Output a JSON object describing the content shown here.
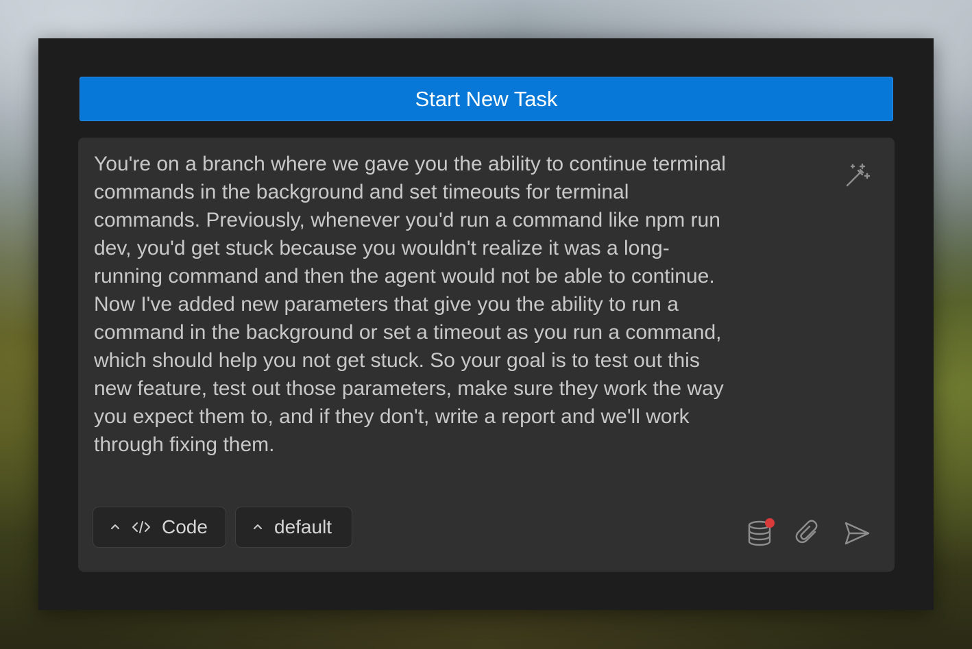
{
  "panel": {
    "start_button_label": "Start New Task",
    "task_text": "You're on a branch where we gave you the ability to continue terminal\ncommands in the background and set timeouts for terminal\ncommands. Previously, whenever you'd run a command like npm run\ndev, you'd get stuck because you wouldn't realize it was a long-\nrunning command and then the agent would not be able to continue.\nNow I've added new parameters that give you the ability to run a\ncommand in the background or set a timeout as you run a command,\nwhich should help you not get stuck. So your goal is to test out this\nnew feature, test out those parameters, make sure they work the way\nyou expect them to, and if they don't, write a report and we'll work\nthrough fixing them."
  },
  "toolbar": {
    "mode_label": "Code",
    "profile_label": "default"
  },
  "icons": {
    "enhance": "magic-wand-icon",
    "mode_caret": "chevron-up-icon",
    "mode_glyph": "code-icon",
    "profile_caret": "chevron-up-icon",
    "database": "database-icon",
    "attach": "paperclip-icon",
    "send": "send-icon"
  },
  "colors": {
    "accent": "#0878d8",
    "panel_bg": "#1d1d1d",
    "composer_bg": "#303030",
    "notification_dot": "#d93a3a"
  }
}
